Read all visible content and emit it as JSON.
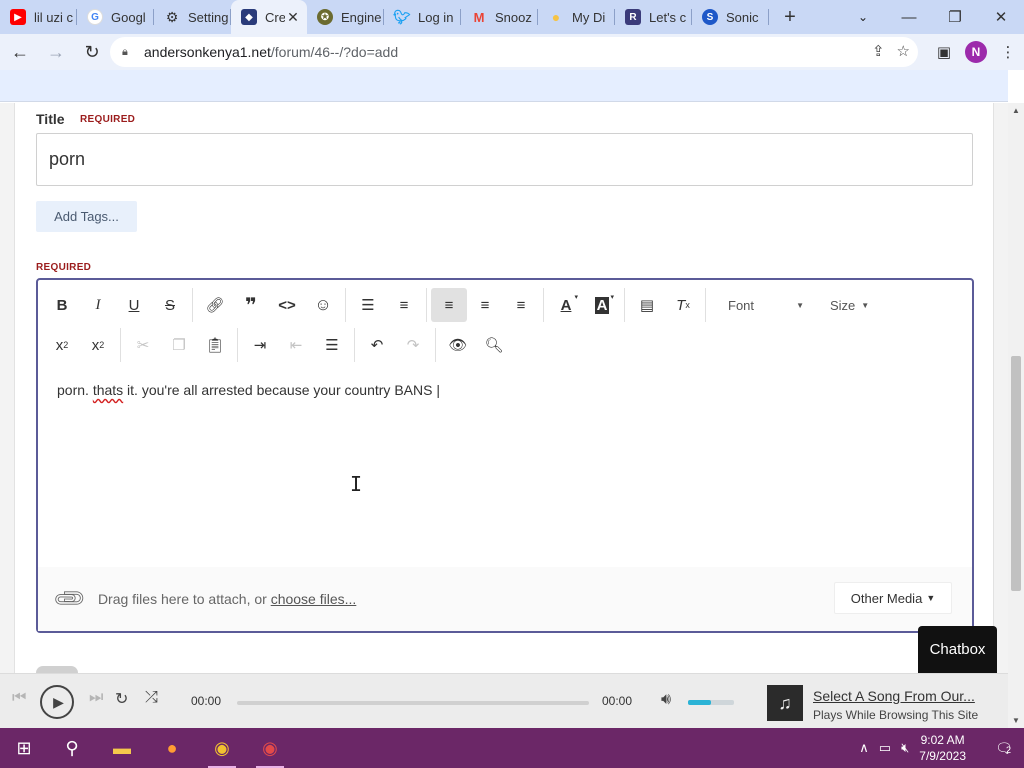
{
  "browser": {
    "tabs": [
      {
        "title": "lil uzi c",
        "favicon": "youtube-icon",
        "color": "#ff0000"
      },
      {
        "title": "Googl",
        "favicon": "google-icon",
        "color": "#4285f4"
      },
      {
        "title": "Setting",
        "favicon": "gear-icon",
        "color": "#5f6368"
      },
      {
        "title": "Cre",
        "favicon": "site-icon",
        "color": "#2a3b7a",
        "active": true
      },
      {
        "title": "Engine",
        "favicon": "engine-icon",
        "color": "#6b6b30"
      },
      {
        "title": "Log in",
        "favicon": "twitter-icon",
        "color": "#1da1f2"
      },
      {
        "title": "Snooz",
        "favicon": "gmail-icon",
        "color": "#ea4335"
      },
      {
        "title": "My Di",
        "favicon": "bulb-icon",
        "color": "#f6c344"
      },
      {
        "title": "Let's c",
        "favicon": "letter-icon",
        "color": "#3b3b7a"
      },
      {
        "title": "Sonic",
        "favicon": "sonic-icon",
        "color": "#1e58c8"
      }
    ],
    "url_host": "andersonkenya1.net",
    "url_path": "/forum/46--/?do=add",
    "profile_initial": "N"
  },
  "form": {
    "title_label": "Title",
    "required_label": "REQUIRED",
    "title_value": "porn",
    "add_tags_label": "Add Tags...",
    "editor_required_label": "REQUIRED",
    "font_label": "Font",
    "size_label": "Size",
    "content_pre": "porn. ",
    "content_misspelt": "thats",
    "content_post": " it. you're all arrested because your country BANS ",
    "attach_text": "Drag files here to attach, or ",
    "attach_link": "choose files...",
    "other_media_label": "Other Media"
  },
  "chatbox_label": "Chatbox",
  "player": {
    "time_elapsed": "00:00",
    "time_total": "00:00",
    "volume_level": 0.5,
    "song_title": "Select A Song From Our...",
    "song_subtitle": "Plays While Browsing This Site"
  },
  "taskbar": {
    "time": "9:02 AM",
    "date": "7/9/2023",
    "notification_count": "2"
  }
}
